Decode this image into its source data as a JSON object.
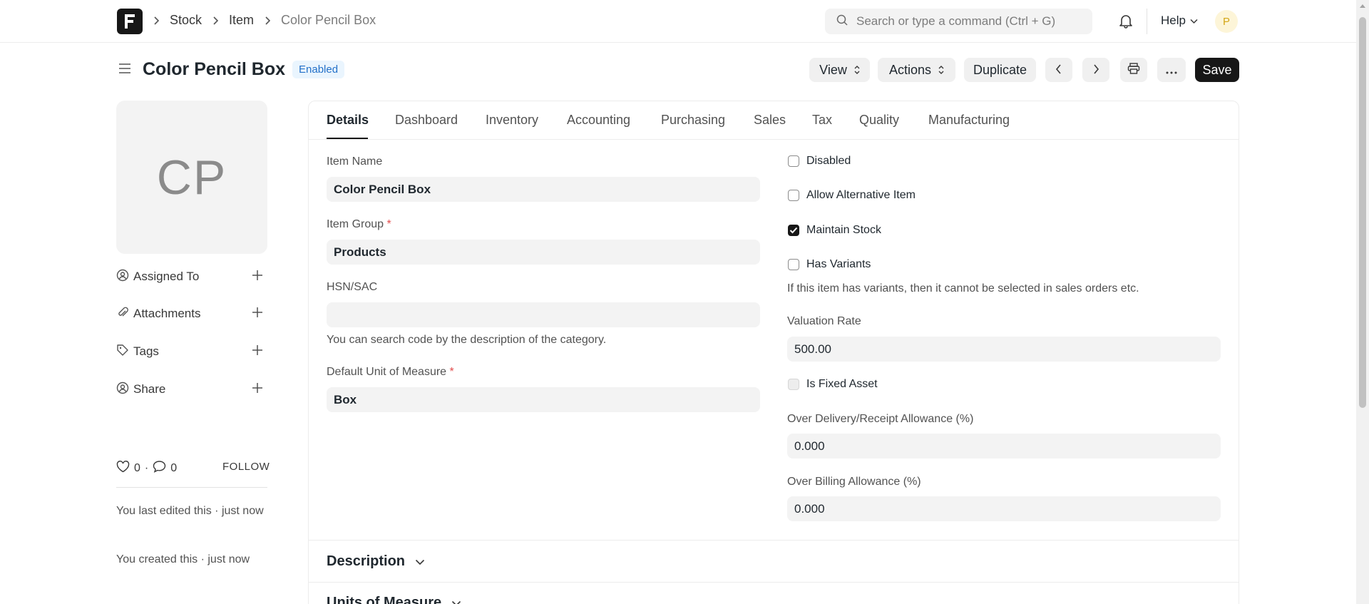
{
  "navbar": {
    "breadcrumbs": [
      "Stock",
      "Item",
      "Color Pencil Box"
    ],
    "search_placeholder": "Search or type a command (Ctrl + G)",
    "help_label": "Help",
    "user_initial": "P"
  },
  "page": {
    "title": "Color Pencil Box",
    "status_badge": "Enabled",
    "buttons": {
      "view": "View",
      "actions": "Actions",
      "duplicate": "Duplicate",
      "save": "Save"
    }
  },
  "sidebar": {
    "avatar_initials": "CP",
    "items": [
      {
        "label": "Assigned To",
        "icon": "user-plus-icon"
      },
      {
        "label": "Attachments",
        "icon": "paperclip-icon"
      },
      {
        "label": "Tags",
        "icon": "tag-icon"
      },
      {
        "label": "Share",
        "icon": "share-user-icon"
      }
    ],
    "likes_count": "0",
    "comments_count": "0",
    "follow_label": "FOLLOW",
    "last_edited": "You last edited this · just now",
    "created": "You created this · just now"
  },
  "tabs": [
    "Details",
    "Dashboard",
    "Inventory",
    "Accounting",
    "Purchasing",
    "Sales",
    "Tax",
    "Quality",
    "Manufacturing"
  ],
  "active_tab": "Details",
  "form": {
    "item_name": {
      "label": "Item Name",
      "value": "Color Pencil Box"
    },
    "item_group": {
      "label": "Item Group",
      "value": "Products",
      "required": true
    },
    "hsn_sac": {
      "label": "HSN/SAC",
      "value": "",
      "hint": "You can search code by the description of the category."
    },
    "uom": {
      "label": "Default Unit of Measure",
      "value": "Box",
      "required": true
    },
    "disabled": {
      "label": "Disabled",
      "checked": false
    },
    "allow_alternative": {
      "label": "Allow Alternative Item",
      "checked": false
    },
    "maintain_stock": {
      "label": "Maintain Stock",
      "checked": true
    },
    "has_variants": {
      "label": "Has Variants",
      "checked": false,
      "hint": "If this item has variants, then it cannot be selected in sales orders etc."
    },
    "valuation_rate": {
      "label": "Valuation Rate",
      "value": "500.00"
    },
    "is_fixed_asset": {
      "label": "Is Fixed Asset",
      "checked": false
    },
    "over_delivery": {
      "label": "Over Delivery/Receipt Allowance (%)",
      "value": "0.000"
    },
    "over_billing": {
      "label": "Over Billing Allowance (%)",
      "value": "0.000"
    }
  },
  "sections": {
    "description": "Description",
    "units_of_measure": "Units of Measure"
  },
  "colors": {
    "primary_button": "#171717",
    "badge_bg": "#eaf5fe",
    "badge_text": "#2471c9",
    "input_bg": "#f3f3f3",
    "required": "#e24c4c"
  }
}
